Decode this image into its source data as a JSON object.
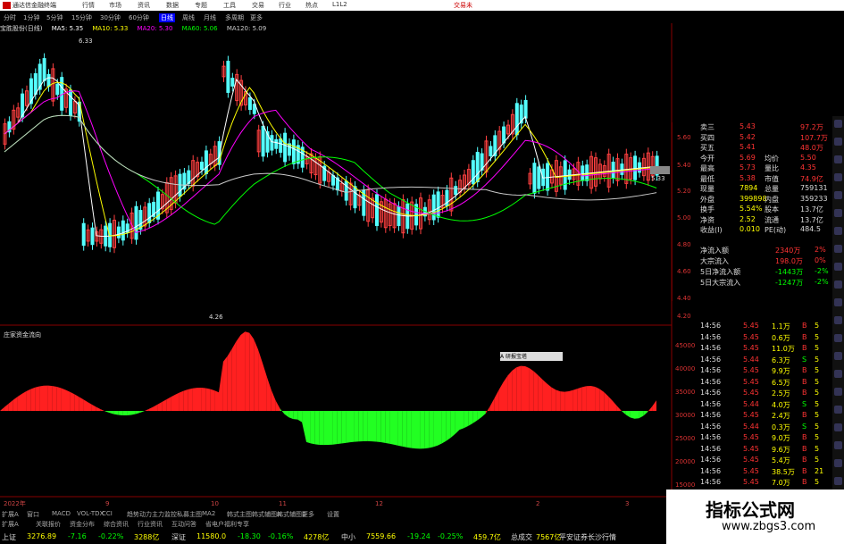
{
  "titlebar": {
    "title": "通达信金融终端",
    "menus": [
      "行情",
      "市场",
      "资讯",
      "数据",
      "专题",
      "工具",
      "交易",
      "行业",
      "热点",
      "L1L2"
    ],
    "right": "交易未"
  },
  "periods": [
    "分时",
    "1分钟",
    "5分钟",
    "15分钟",
    "30分钟",
    "60分钟",
    "日线",
    "周线",
    "月线",
    "多周期",
    "更多"
  ],
  "selected_period": "日线",
  "ma_legend": {
    "stock": "宝胜股份(日线)",
    "ma5": "MA5: 5.35",
    "ma10": "MA10: 5.33",
    "ma20": "MA20: 5.30",
    "ma60": "MA60: 5.06",
    "ma120": "MA120: 5.09"
  },
  "price_marks": {
    "high": "6.33",
    "low": "4.26",
    "last": "5.33"
  },
  "price_axis": [
    "5.60",
    "5.40",
    "5.20",
    "5.00",
    "4.80",
    "4.60",
    "4.40",
    "4.20"
  ],
  "ind_axis": [
    "45000",
    "40000",
    "35000",
    "30000",
    "25000",
    "20000",
    "15000"
  ],
  "indicator_label": "庄家资金流向",
  "chip_label": "A 研报宝塔",
  "quotes": [
    {
      "l": "卖三",
      "v": "5.43",
      "v2": "97.2万"
    },
    {
      "l": "买四",
      "v": "5.42",
      "v2": "107.7万"
    },
    {
      "l": "买五",
      "v": "5.41",
      "v2": "48.0万"
    },
    {
      "l": "今开",
      "v": "5.69",
      "l2": "均价",
      "v2": "5.50"
    },
    {
      "l": "最高",
      "v": "5.73",
      "l2": "量比",
      "v2": "4.35"
    },
    {
      "l": "最低",
      "v": "5.38",
      "l2": "市值",
      "v2": "74.9亿"
    },
    {
      "l": "现量",
      "v": "7894",
      "l2": "总量",
      "v2": "759131"
    },
    {
      "l": "外盘",
      "v": "399898",
      "l2": "内盘",
      "v2": "359233"
    },
    {
      "l": "换手",
      "v": "5.54%",
      "l2": "股本",
      "v2": "13.7亿"
    },
    {
      "l": "净资",
      "v": "2.52",
      "l2": "流通",
      "v2": "13.7亿"
    },
    {
      "l": "收益(I)",
      "v": "0.010",
      "l2": "PE(动)",
      "v2": "484.5"
    }
  ],
  "flows": [
    {
      "l": "净流入额",
      "v": "2340万",
      "p": "2%"
    },
    {
      "l": "大宗流入",
      "v": "198.0万",
      "p": "0%"
    },
    {
      "l": "5日净流入额",
      "v": "-1443万",
      "p": "-2%"
    },
    {
      "l": "5日大宗流入",
      "v": "-1247万",
      "p": "-2%"
    }
  ],
  "trades": [
    [
      "14:56",
      "5.45",
      "1.1万",
      "B",
      "5"
    ],
    [
      "14:56",
      "5.45",
      "0.6万",
      "B",
      "5"
    ],
    [
      "14:56",
      "5.45",
      "11.0万",
      "B",
      "5"
    ],
    [
      "14:56",
      "5.44",
      "6.3万",
      "S",
      "5"
    ],
    [
      "14:56",
      "5.45",
      "9.9万",
      "B",
      "5"
    ],
    [
      "14:56",
      "5.45",
      "6.5万",
      "B",
      "5"
    ],
    [
      "14:56",
      "5.45",
      "2.5万",
      "B",
      "5"
    ],
    [
      "14:56",
      "5.44",
      "4.0万",
      "S",
      "5"
    ],
    [
      "14:56",
      "5.45",
      "2.4万",
      "B",
      "5"
    ],
    [
      "14:56",
      "5.44",
      "0.3万",
      "S",
      "5"
    ],
    [
      "14:56",
      "5.45",
      "9.0万",
      "B",
      "5"
    ],
    [
      "14:56",
      "5.45",
      "9.6万",
      "B",
      "5"
    ],
    [
      "14:56",
      "5.45",
      "5.4万",
      "B",
      "5"
    ],
    [
      "14:56",
      "5.45",
      "38.5万",
      "B",
      "21"
    ],
    [
      "14:56",
      "5.45",
      "7.0万",
      "B",
      "5"
    ]
  ],
  "tabs": [
    "扩展A",
    "窗口",
    "MACD",
    "VOL-TDX",
    "CCI",
    "趋势动力",
    "主力监控",
    "私募主图",
    "MA2",
    "韩式主图",
    "韩式辅图A",
    "韩式辅图B",
    "更多",
    "设置"
  ],
  "tabs2": [
    "扩展A",
    "关联报价",
    "资金分布",
    "综合资讯",
    "行业资讯",
    "互动问答",
    "省电户福利专享"
  ],
  "index_bar": [
    {
      "n": "上证",
      "v": "3276.89",
      "c": "-7.16",
      "p": "-0.22%",
      "a": "3288亿"
    },
    {
      "n": "深证",
      "v": "11580.0",
      "c": "-18.30",
      "p": "-0.16%",
      "a": "4278亿"
    },
    {
      "n": "中小",
      "v": "7559.66",
      "c": "-19.24",
      "p": "-0.25%",
      "a": "459.7亿"
    },
    {
      "n": "总成交",
      "v": "7567亿",
      "c": "",
      "p": "",
      "a": ""
    }
  ],
  "broker": "平安证券长沙行情",
  "watermark": {
    "title": "指标公式网",
    "url": "www.zbgs3.com"
  },
  "xaxis": [
    "2022年",
    "9",
    "10",
    "11",
    "12",
    "2",
    "3"
  ],
  "colors": {
    "up": "#ff3232",
    "down": "#54ffff",
    "green": "#22ff22",
    "red": "#ff2020",
    "ma5": "#ffffff",
    "ma10": "#ffff00",
    "ma20": "#ff00ff",
    "ma60": "#00ff00",
    "ma120": "#c8c8c8"
  }
}
